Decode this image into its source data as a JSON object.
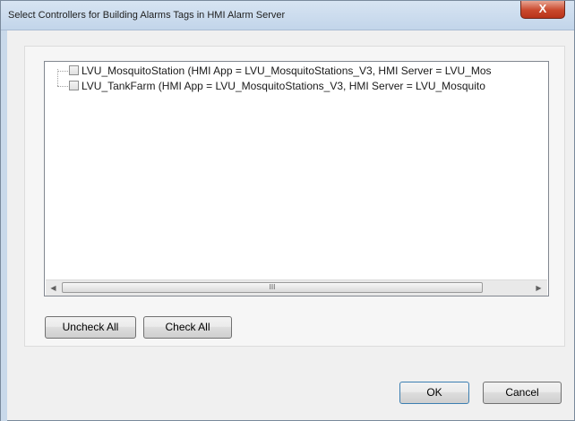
{
  "window": {
    "title": "Select Controllers for Building Alarms Tags in HMI Alarm Server",
    "close_glyph": "X"
  },
  "tree": {
    "nodes": [
      {
        "label": "LVU_MosquitoStation  (HMI App = LVU_MosquitoStations_V3, HMI Server = LVU_Mos",
        "checked": false
      },
      {
        "label": "LVU_TankFarm  (HMI App = LVU_MosquitoStations_V3, HMI Server = LVU_Mosquito",
        "checked": false
      }
    ],
    "scrollbar": {
      "left_arrow": "◀",
      "right_arrow": "▶",
      "thumb_grip": "III"
    }
  },
  "buttons": {
    "uncheck_all": "Uncheck All",
    "check_all": "Check All",
    "ok": "OK",
    "cancel": "Cancel"
  }
}
